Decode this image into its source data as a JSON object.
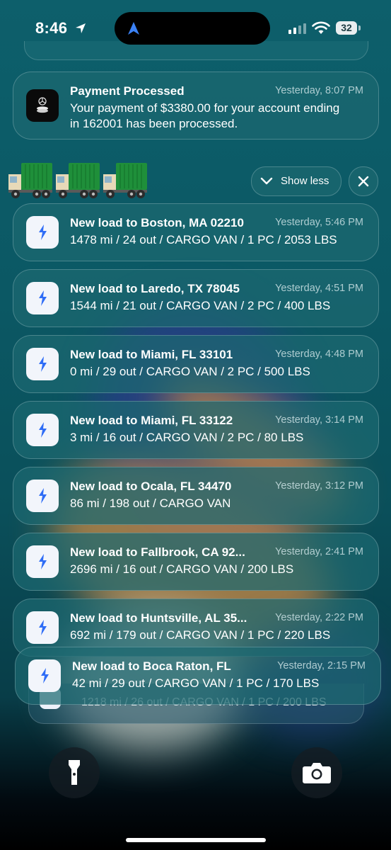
{
  "status_bar": {
    "time": "8:46",
    "battery": "32",
    "icons": [
      "location-arrow-icon",
      "navigation-arrow-icon",
      "cellular-signal-icon",
      "wifi-icon",
      "battery-icon"
    ]
  },
  "payment_notification": {
    "title": "Payment Processed",
    "time": "Yesterday, 8:07 PM",
    "body_line1": "Your payment of $3380.00 for your account ending",
    "body_line2": "in 162001 has been processed."
  },
  "group_header": {
    "emoji": "🚛🚛🚛",
    "show_less_label": "Show less"
  },
  "loads": [
    {
      "title": "New load to Boston, MA 02210",
      "time": "Yesterday, 5:46 PM",
      "details": "1478 mi / 24 out / CARGO VAN / 1 PC / 2053 LBS"
    },
    {
      "title": "New load to Laredo, TX 78045",
      "time": "Yesterday, 4:51 PM",
      "details": "1544 mi / 21 out / CARGO VAN / 2 PC / 400 LBS"
    },
    {
      "title": "New load to Miami, FL 33101",
      "time": "Yesterday, 4:48 PM",
      "details": "0 mi / 29 out / CARGO VAN / 2 PC / 500 LBS"
    },
    {
      "title": "New load to Miami, FL 33122",
      "time": "Yesterday, 3:14 PM",
      "details": "3 mi / 16 out / CARGO VAN / 2 PC / 80 LBS"
    },
    {
      "title": "New load to Ocala, FL 34470",
      "time": "Yesterday, 3:12 PM",
      "details": "86 mi / 198 out / CARGO VAN"
    },
    {
      "title": "New load to Fallbrook, CA 92...",
      "time": "Yesterday, 2:41 PM",
      "details": "2696 mi / 16 out / CARGO VAN / 200 LBS"
    },
    {
      "title": "New load to Huntsville, AL 35...",
      "time": "Yesterday, 2:22 PM",
      "details": "692 mi / 179 out / CARGO VAN / 1 PC / 220 LBS"
    },
    {
      "title": "New load to Boca Raton, FL",
      "time": "Yesterday, 2:15 PM",
      "details": "42 mi / 29 out / CARGO VAN / 1 PC / 170 LBS"
    }
  ],
  "stack_ghost_text": "1218 mi / 26 out / CARGO VAN / 1 PC / 200 LBS",
  "quick_actions": [
    "flashlight-icon",
    "camera-icon"
  ],
  "colors": {
    "accent_blue": "#2f6df6",
    "card_bg": "#1c6870"
  }
}
